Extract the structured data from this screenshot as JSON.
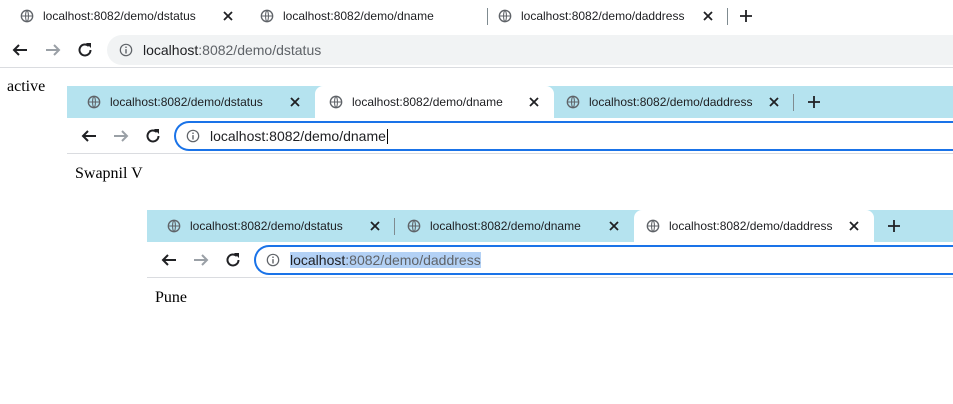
{
  "window1": {
    "tabs": [
      {
        "label": "localhost:8082/demo/dstatus",
        "active": true
      },
      {
        "label": "localhost:8082/demo/dname",
        "active": false
      },
      {
        "label": "localhost:8082/demo/daddress",
        "active": false
      }
    ],
    "address": {
      "host": "localhost",
      "path": ":8082/demo/dstatus"
    },
    "content": "active"
  },
  "window2": {
    "tabs": [
      {
        "label": "localhost:8082/demo/dstatus",
        "active": false
      },
      {
        "label": "localhost:8082/demo/dname",
        "active": true
      },
      {
        "label": "localhost:8082/demo/daddress",
        "active": false
      }
    ],
    "address": {
      "host": "localhost",
      "path": ":8082/demo/dname"
    },
    "content": "Swapnil V"
  },
  "window3": {
    "tabs": [
      {
        "label": "localhost:8082/demo/dstatus",
        "active": false
      },
      {
        "label": "localhost:8082/demo/dname",
        "active": false
      },
      {
        "label": "localhost:8082/demo/daddress",
        "active": true
      }
    ],
    "address": {
      "host": "localhost",
      "path": ":8082/demo/daddress"
    },
    "content": "Pune"
  },
  "icons": {
    "tab_favicon": "globe-icon",
    "tab_close": "close-icon",
    "new_tab": "plus-icon",
    "back": "arrow-left-icon",
    "forward": "arrow-right-icon",
    "reload": "reload-icon",
    "site_info": "info-icon"
  },
  "colors": {
    "tabstrip_inactive_window": "#b5e3ef",
    "focus_ring": "#1a73e8",
    "selection": "#b3d1f5",
    "omnibox_bg": "#f1f3f4"
  }
}
